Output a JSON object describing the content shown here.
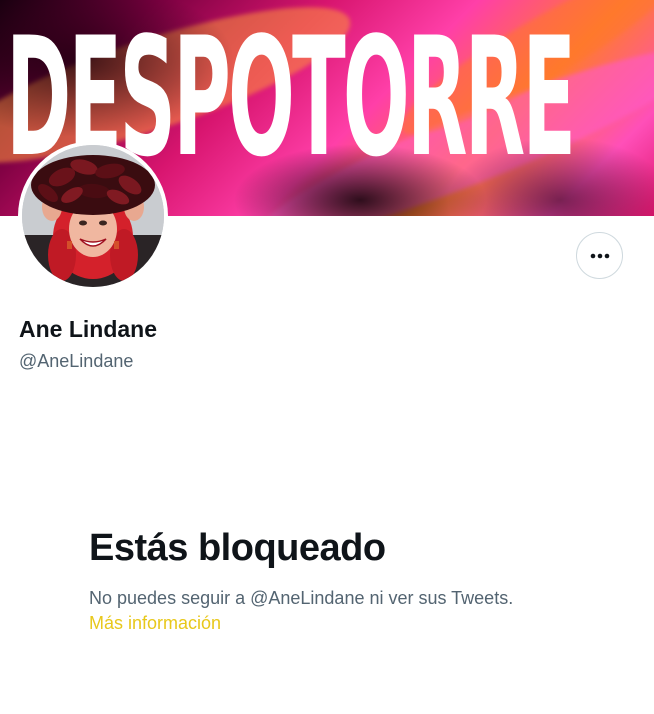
{
  "banner": {
    "text": "DESPOTORRE"
  },
  "profile": {
    "name": "Ane Lindane",
    "handle": "@AneLindane",
    "more_button_icon": "more-horizontal-icon"
  },
  "blocked": {
    "title": "Estás bloqueado",
    "description": "No puedes seguir a @AneLindane ni ver sus Tweets.",
    "more_info_link": "Más información"
  },
  "colors": {
    "text_primary": "#0f1419",
    "text_secondary": "#536471",
    "link_accent": "#e8c81b",
    "border": "#cfd9de"
  }
}
